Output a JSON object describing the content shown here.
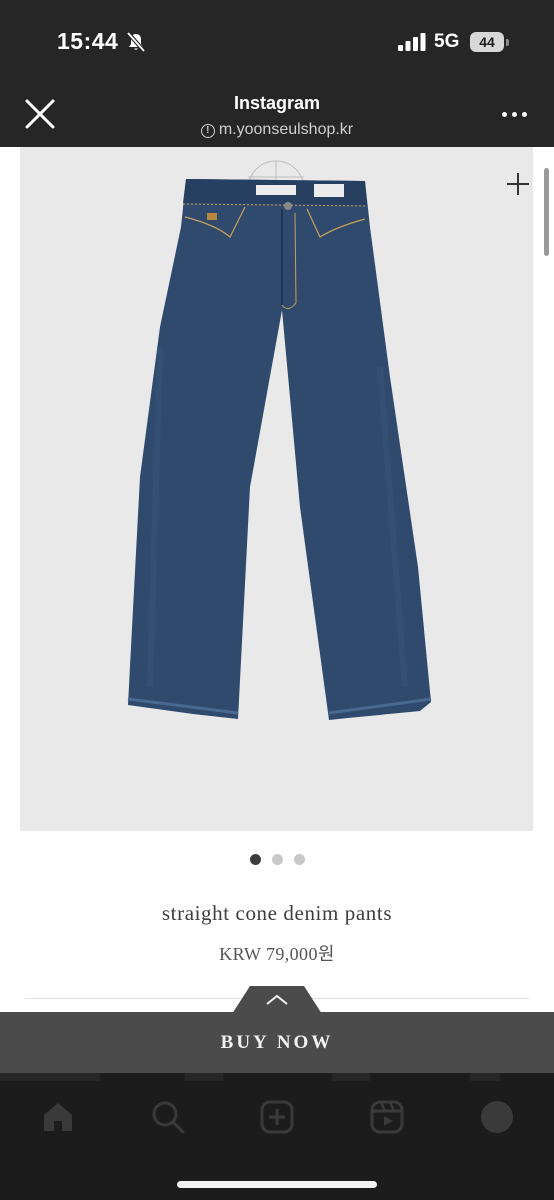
{
  "status_bar": {
    "time": "15:44",
    "mute_icon": "bell-slash-icon",
    "network": "5G",
    "battery": "44"
  },
  "browser": {
    "app_title": "Instagram",
    "url": "m.yoonseulshop.kr",
    "close_icon": "close-icon",
    "more_icon": "more-horizontal-icon",
    "info_icon": "info-circle-icon"
  },
  "product": {
    "name": "straight cone denim pants",
    "price": "KRW 79,000원",
    "image_icon": "denim-pants-image",
    "zoom_icon": "plus-icon",
    "slides_total": 3,
    "active_slide": 1
  },
  "buy_bar": {
    "label": "BUY NOW",
    "toggle_icon": "chevron-up-icon"
  },
  "tab_bar": {
    "items": [
      "home-icon",
      "search-icon",
      "create-post-icon",
      "reels-icon",
      "profile-avatar"
    ]
  },
  "colors": {
    "chrome_bg": "#262626",
    "buy_bar_bg": "#4b4b4b",
    "photo_bg": "#e9e9e9",
    "denim": "#2f4a6c"
  }
}
